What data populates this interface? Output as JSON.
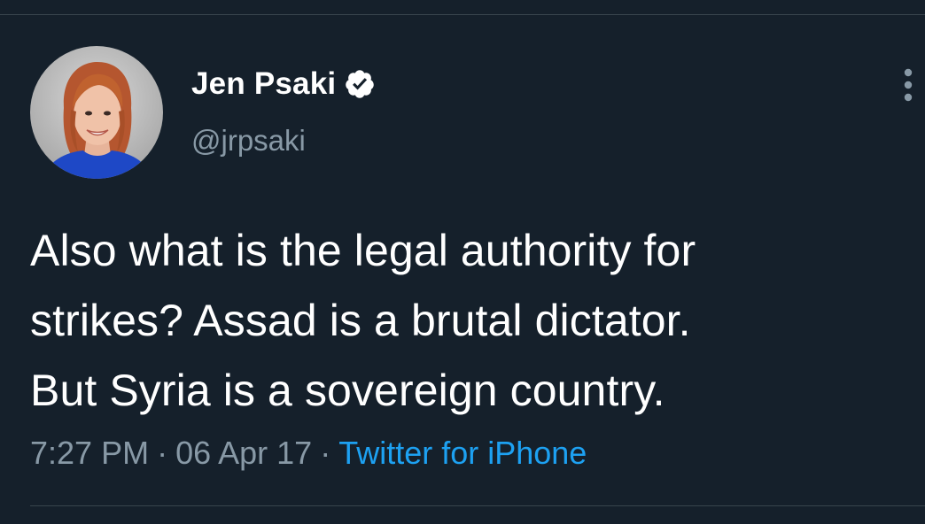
{
  "tweet": {
    "author": {
      "display_name": "Jen Psaki",
      "handle": "@jrpsaki",
      "verified": true,
      "avatar_icon": "profile-photo"
    },
    "text_lines": [
      "Also what is the legal authority for",
      "strikes? Assad is a brutal dictator.",
      "But Syria is a sovereign country."
    ],
    "time": "7:27 PM",
    "date": "06 Apr 17",
    "separator": "·",
    "source": "Twitter for iPhone",
    "more_icon": "more-vertical-icon"
  },
  "colors": {
    "background": "#15202b",
    "text_primary": "#ffffff",
    "text_secondary": "#8899a6",
    "link": "#1da1f2",
    "divider": "#38444d"
  }
}
